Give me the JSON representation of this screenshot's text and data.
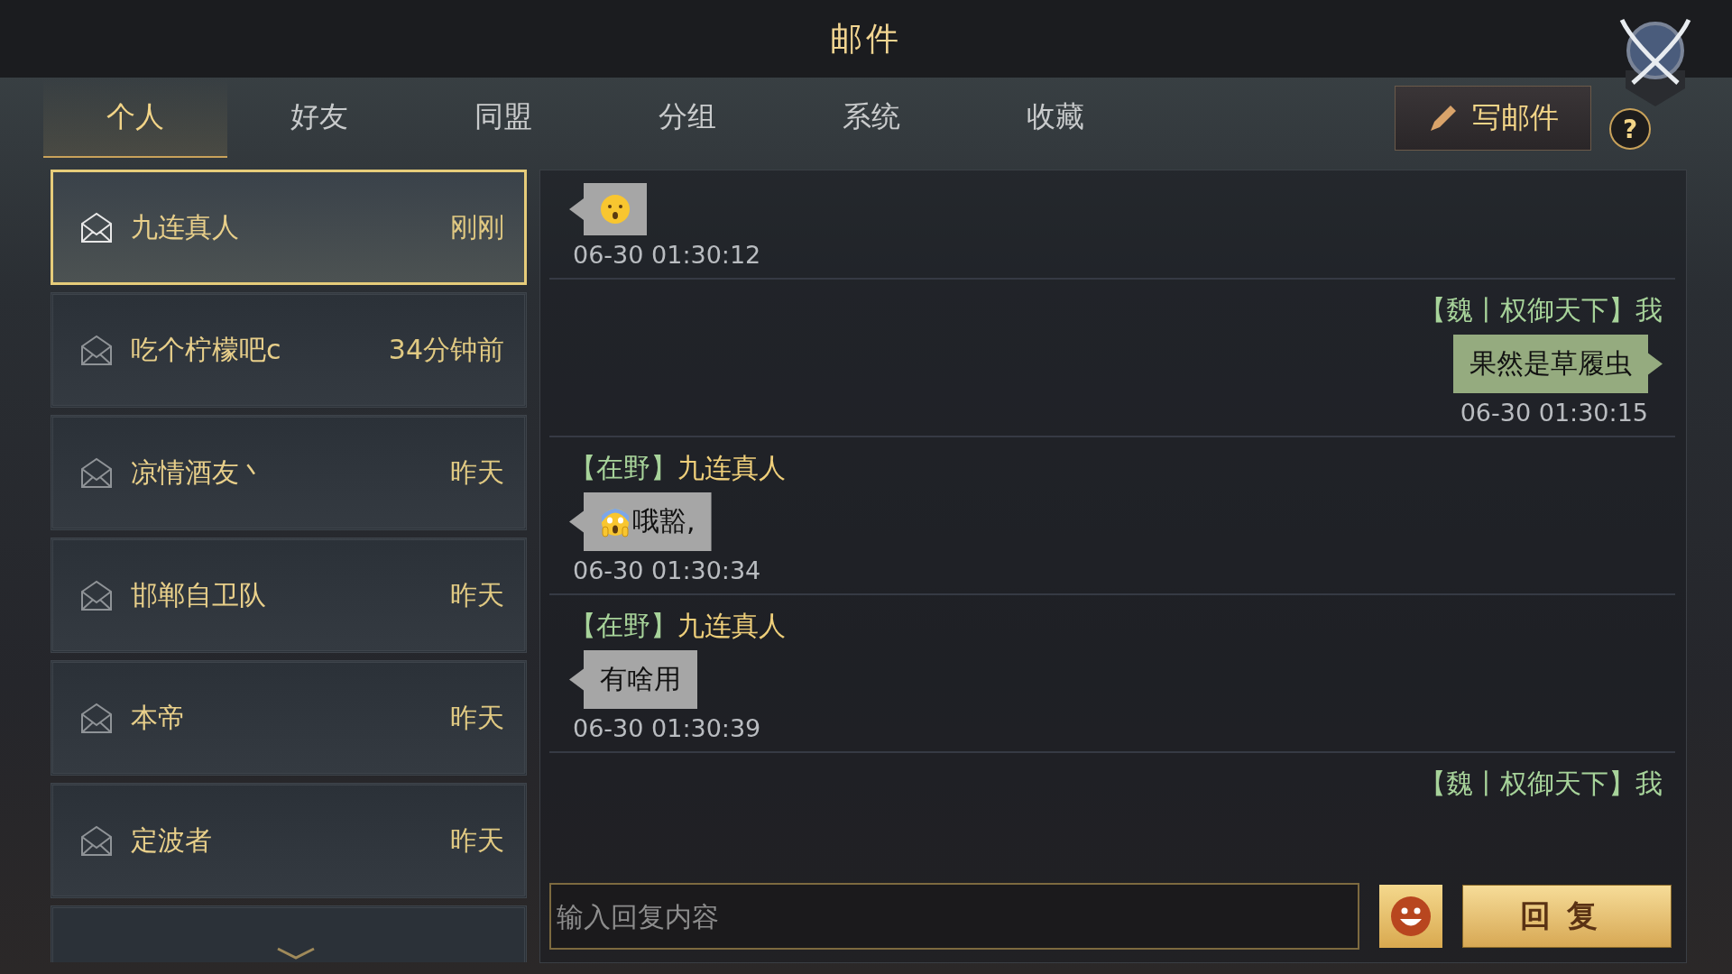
{
  "title": "邮件",
  "tabs": [
    {
      "label": "个人",
      "selected": true
    },
    {
      "label": "好友",
      "selected": false
    },
    {
      "label": "同盟",
      "selected": false
    },
    {
      "label": "分组",
      "selected": false
    },
    {
      "label": "系统",
      "selected": false
    },
    {
      "label": "收藏",
      "selected": false
    }
  ],
  "compose_button": "写邮件",
  "help_button": "?",
  "mail_list": [
    {
      "name": "九连真人",
      "time": "刚刚",
      "selected": true
    },
    {
      "name": "吃个柠檬吧c",
      "time": "34分钟前",
      "selected": false
    },
    {
      "name": "凉情酒友丶",
      "time": "昨天",
      "selected": false
    },
    {
      "name": "邯郸自卫队",
      "time": "昨天",
      "selected": false
    },
    {
      "name": "本帝",
      "time": "昨天",
      "selected": false
    },
    {
      "name": "定波者",
      "time": "昨天",
      "selected": false
    }
  ],
  "messages": [
    {
      "kind": "incoming",
      "bubble": {
        "kind": "surprised"
      },
      "time": "06-30 01:30:12"
    },
    {
      "kind": "outgoing",
      "tag": "【魏丨权御天下】",
      "name": "我",
      "bubble": {
        "kind": "text",
        "text": "果然是草履虫"
      },
      "time": "06-30 01:30:15"
    },
    {
      "kind": "incoming",
      "tag": "【在野】",
      "name": "九连真人",
      "bubble": {
        "kind": "scream",
        "text": "哦豁,"
      },
      "time": "06-30 01:30:34"
    },
    {
      "kind": "incoming",
      "tag": "【在野】",
      "name": "九连真人",
      "bubble": {
        "kind": "text",
        "text": "有啥用"
      },
      "time": "06-30 01:30:39"
    },
    {
      "kind": "outgoing",
      "tag": "【魏丨权御天下】",
      "name": "我"
    }
  ],
  "reply_input": {
    "placeholder": "输入回复内容"
  },
  "reply_button": "回复"
}
